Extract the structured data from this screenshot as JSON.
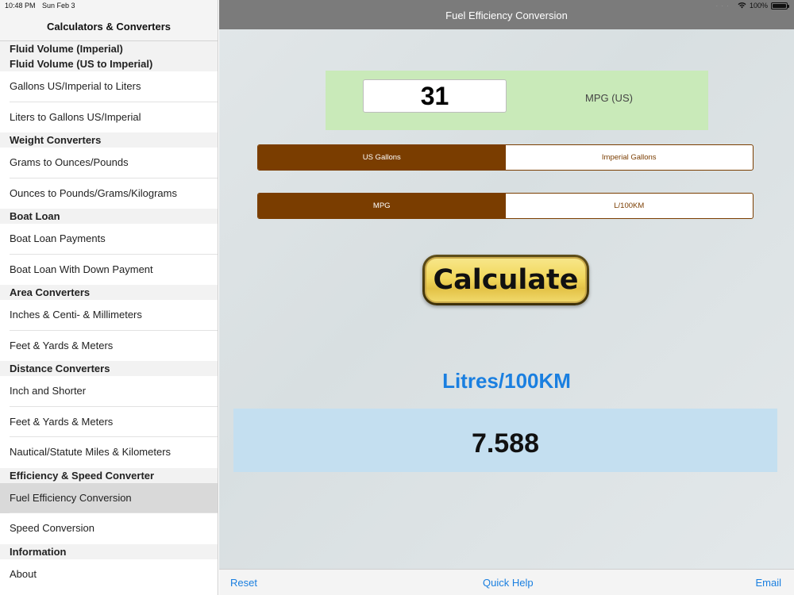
{
  "status": {
    "time": "10:48 PM",
    "date": "Sun Feb 3",
    "battery": "100%",
    "battery_level": 1.0
  },
  "sidebar": {
    "title": "Calculators & Converters",
    "rows": [
      {
        "type": "section",
        "label": "Fluid Volume (Imperial)"
      },
      {
        "type": "section",
        "label": "Fluid Volume (US to Imperial)"
      },
      {
        "type": "item",
        "label": "Gallons US/Imperial to Liters"
      },
      {
        "type": "item",
        "label": "Liters to Gallons US/Imperial"
      },
      {
        "type": "section",
        "label": "Weight Converters"
      },
      {
        "type": "item",
        "label": "Grams to Ounces/Pounds"
      },
      {
        "type": "item",
        "label": "Ounces to Pounds/Grams/Kilograms"
      },
      {
        "type": "section",
        "label": "Boat Loan"
      },
      {
        "type": "item",
        "label": "Boat Loan Payments"
      },
      {
        "type": "item",
        "label": "Boat Loan With Down Payment"
      },
      {
        "type": "section",
        "label": "Area Converters"
      },
      {
        "type": "item",
        "label": "Inches & Centi- & Millimeters"
      },
      {
        "type": "item",
        "label": "Feet & Yards & Meters"
      },
      {
        "type": "section",
        "label": "Distance Converters"
      },
      {
        "type": "item",
        "label": "Inch and Shorter"
      },
      {
        "type": "item",
        "label": "Feet & Yards & Meters"
      },
      {
        "type": "item",
        "label": "Nautical/Statute Miles & Kilometers"
      },
      {
        "type": "section",
        "label": "Efficiency & Speed Converter"
      },
      {
        "type": "item",
        "label": "Fuel Efficiency Conversion",
        "selected": true
      },
      {
        "type": "item",
        "label": "Speed Conversion"
      },
      {
        "type": "section",
        "label": "Information"
      },
      {
        "type": "item",
        "label": "About"
      }
    ]
  },
  "nav": {
    "title": "Fuel Efficiency Conversion"
  },
  "input": {
    "value": "31",
    "unit_label": "MPG (US)"
  },
  "gallon_selector": {
    "options": [
      "US Gallons",
      "Imperial Gallons"
    ],
    "selected": 0
  },
  "mode_selector": {
    "options": [
      "MPG",
      "L/100KM"
    ],
    "selected": 0
  },
  "calculate_label": "Calculate",
  "result": {
    "label": "Litres/100KM",
    "value": "7.588"
  },
  "toolbar": {
    "reset": "Reset",
    "quick_help": "Quick Help",
    "email": "Email"
  },
  "colors": {
    "accent_brown": "#7a3d00",
    "link_blue": "#1a7fe0",
    "input_panel": "#c9eab9",
    "result_panel": "#c4dff0"
  }
}
